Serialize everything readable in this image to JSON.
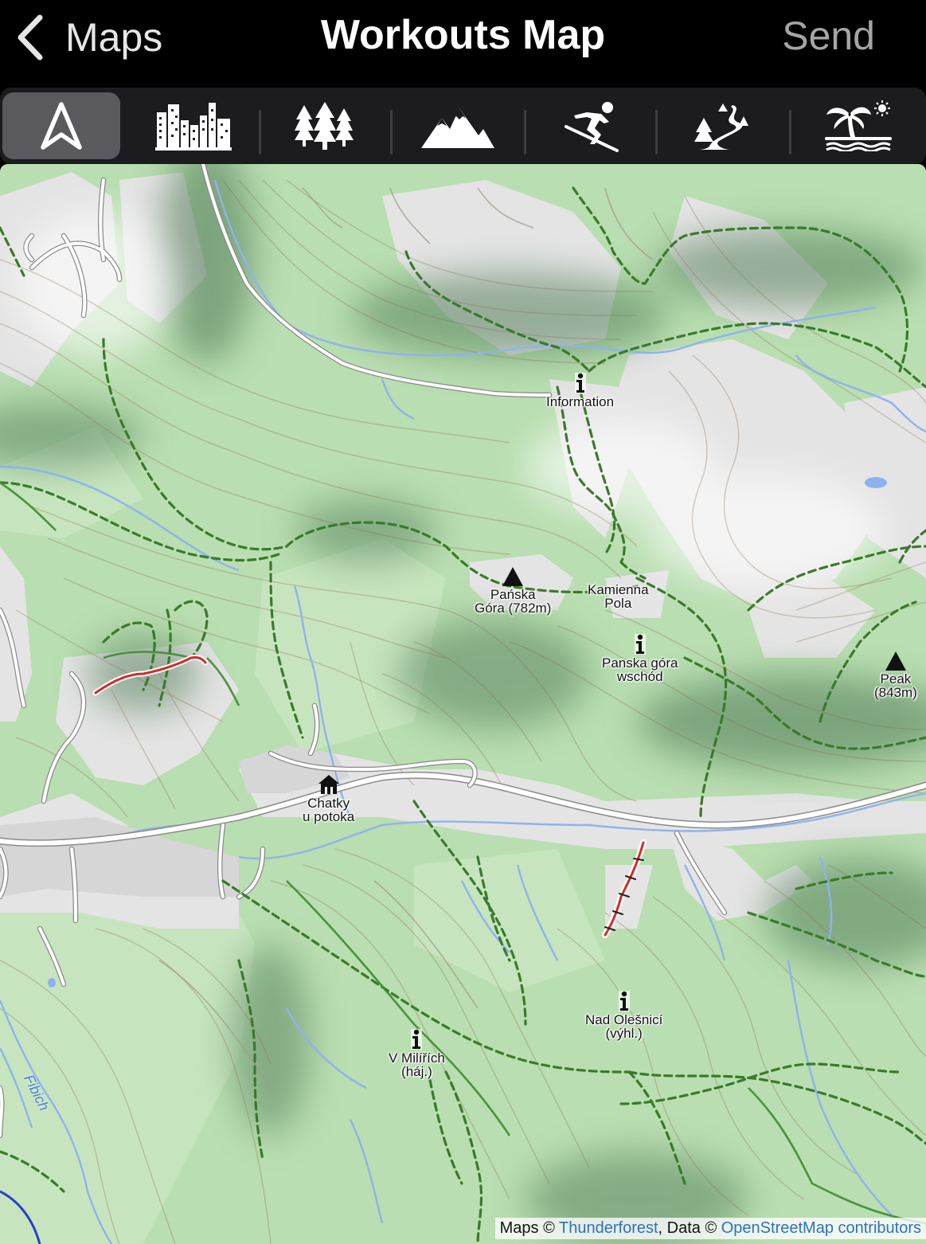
{
  "nav": {
    "back_label": "Maps",
    "title": "Workouts Map",
    "send_label": "Send"
  },
  "map_styles": [
    {
      "icon": "navigation-arrow-icon",
      "active": true
    },
    {
      "icon": "city-skyline-icon",
      "active": false
    },
    {
      "icon": "forest-trees-icon",
      "active": false
    },
    {
      "icon": "mountains-icon",
      "active": false
    },
    {
      "icon": "skier-icon",
      "active": false
    },
    {
      "icon": "trail-path-icon",
      "active": false
    },
    {
      "icon": "palm-beach-icon",
      "active": false
    }
  ],
  "map": {
    "pois": {
      "information": "Information",
      "panska_gora_name": "Pańska",
      "panska_gora_elev": "Góra (782m)",
      "kamienna_1": "Kamienna",
      "kamienna_2": "Pola",
      "panska_wschod_1": "Panska góra",
      "panska_wschod_2": "wschód",
      "peak_1": "Peak",
      "peak_2": "(843m)",
      "chatky_1": "Chatky",
      "chatky_2": "u potoka",
      "nad_olesnici_1": "Nad Olešnicí",
      "nad_olesnici_2": "(výhl.)",
      "v_milirich_1": "V Milířích",
      "v_milirich_2": "(háj.)"
    },
    "river_label": "Fibich",
    "attribution": {
      "maps_prefix": "Maps ©",
      "thunderforest": "Thunderforest",
      "data_prefix": ", Data ©",
      "osm": "OpenStreetMap contributors"
    },
    "colors": {
      "land": "#b9deb1",
      "meadow": "#e6e6e6",
      "water": "#9cbcec",
      "path": "#3f7f2e",
      "workout": "#d42a2a"
    }
  }
}
